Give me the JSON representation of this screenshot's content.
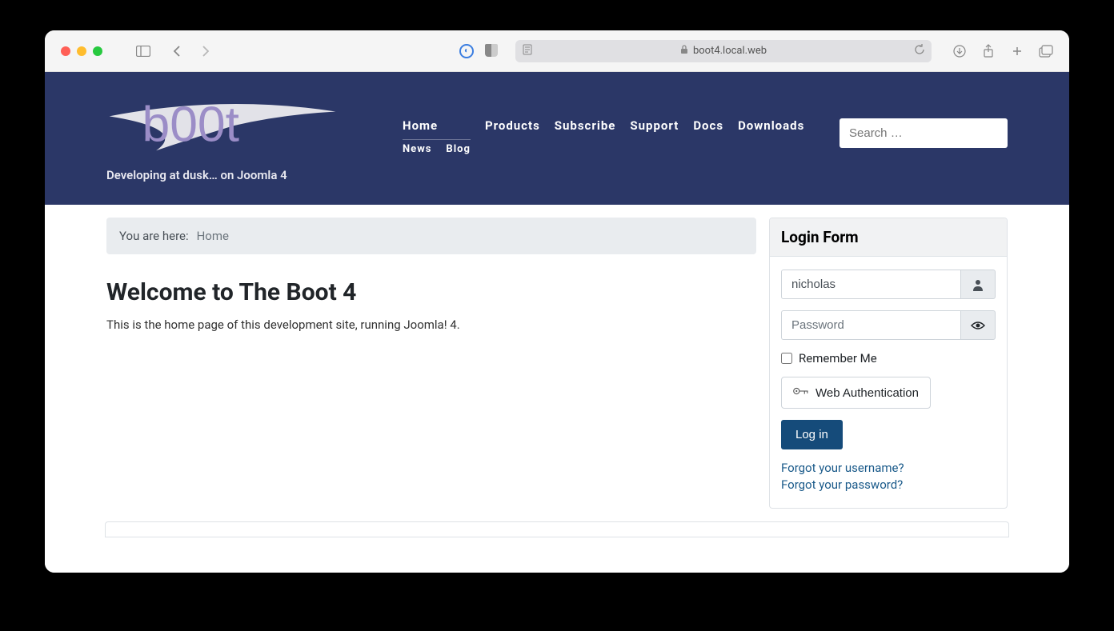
{
  "browser": {
    "url": "boot4.local.web"
  },
  "site": {
    "logo_text": "b00t",
    "tagline": "Developing at dusk… on Joomla 4"
  },
  "nav": {
    "home": "Home",
    "news": "News",
    "blog": "Blog",
    "products": "Products",
    "subscribe": "Subscribe",
    "support": "Support",
    "docs": "Docs",
    "downloads": "Downloads"
  },
  "search": {
    "placeholder": "Search …"
  },
  "breadcrumb": {
    "label": "You are here:",
    "current": "Home"
  },
  "main": {
    "title": "Welcome to The Boot 4",
    "text": "This is the home page of this development site, running Joomla! 4."
  },
  "login": {
    "title": "Login Form",
    "username_value": "nicholas",
    "password_placeholder": "Password",
    "remember": "Remember Me",
    "webauthn": "Web Authentication",
    "submit": "Log in",
    "forgot_username": "Forgot your username?",
    "forgot_password": "Forgot your password?"
  }
}
